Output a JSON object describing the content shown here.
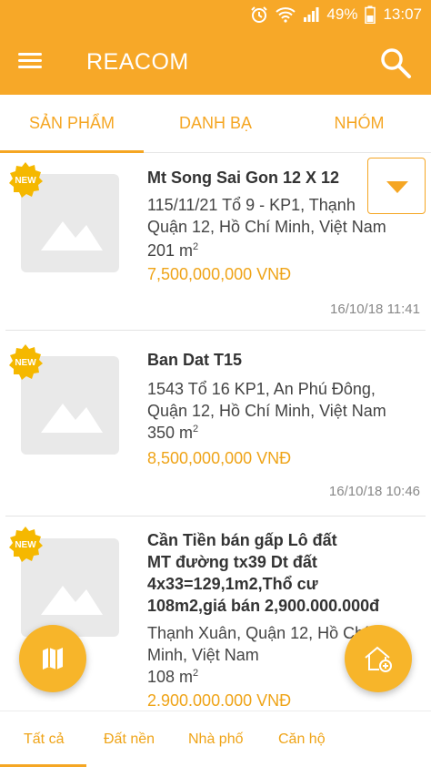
{
  "status_bar": {
    "battery": "49%",
    "time": "13:07",
    "icons": [
      "alarm-icon",
      "wifi-icon",
      "signal-icon",
      "battery-icon"
    ]
  },
  "app_bar": {
    "title": "REACOM",
    "menu_icon": "menu-icon",
    "search_icon": "search-icon"
  },
  "tabs": [
    {
      "label": "SẢN PHẨM",
      "active": true
    },
    {
      "label": "DANH BẠ",
      "active": false
    },
    {
      "label": "NHÓM",
      "active": false
    }
  ],
  "badge_label": "NEW",
  "listings": [
    {
      "title": "Mt Song Sai Gon 12 X 12",
      "address_line1": "115/11/21 Tổ 9 - KP1, Thạnh",
      "address_line2": "Quận 12, Hồ Chí Minh, Việt Nam",
      "area": "201 m",
      "area_unit_sup": "2",
      "price": "7,500,000,000 VNĐ",
      "date": "16/10/18 11:41"
    },
    {
      "title": "Ban Dat T15",
      "address_line1": "1543 Tổ 16 KP1, An Phú Đông,",
      "address_line2": "Quận 12, Hồ Chí Minh, Việt Nam",
      "area": "350 m",
      "area_unit_sup": "2",
      "price": "8,500,000,000 VNĐ",
      "date": "16/10/18 10:46"
    },
    {
      "title_line1": "Cần Tiền bán gấp Lô đất",
      "title_line2": "MT đường tx39 Dt đất",
      "title_line3": "4x33=129,1m2,Thổ cư",
      "title_line4": "108m2,giá bán 2,900.000.000đ",
      "address_line1": "Thạnh Xuân, Quận 12, Hồ Chí",
      "address_line2": "Minh, Việt Nam",
      "area": "108 m",
      "area_unit_sup": "2",
      "price": "2.900.000.000 VNĐ"
    }
  ],
  "fab_left_icon": "map-icon",
  "fab_right_icon": "add-home-icon",
  "dropdown_icon": "caret-down-icon",
  "bottom_nav": [
    {
      "label": "Tất cả",
      "active": true
    },
    {
      "label": "Đất nền",
      "active": false
    },
    {
      "label": "Nhà phố",
      "active": false
    },
    {
      "label": "Căn hộ",
      "active": false
    }
  ],
  "colors": {
    "primary": "#F7A828",
    "accent_text": "#EFA418",
    "thumb_bg": "#e9e9e9"
  }
}
